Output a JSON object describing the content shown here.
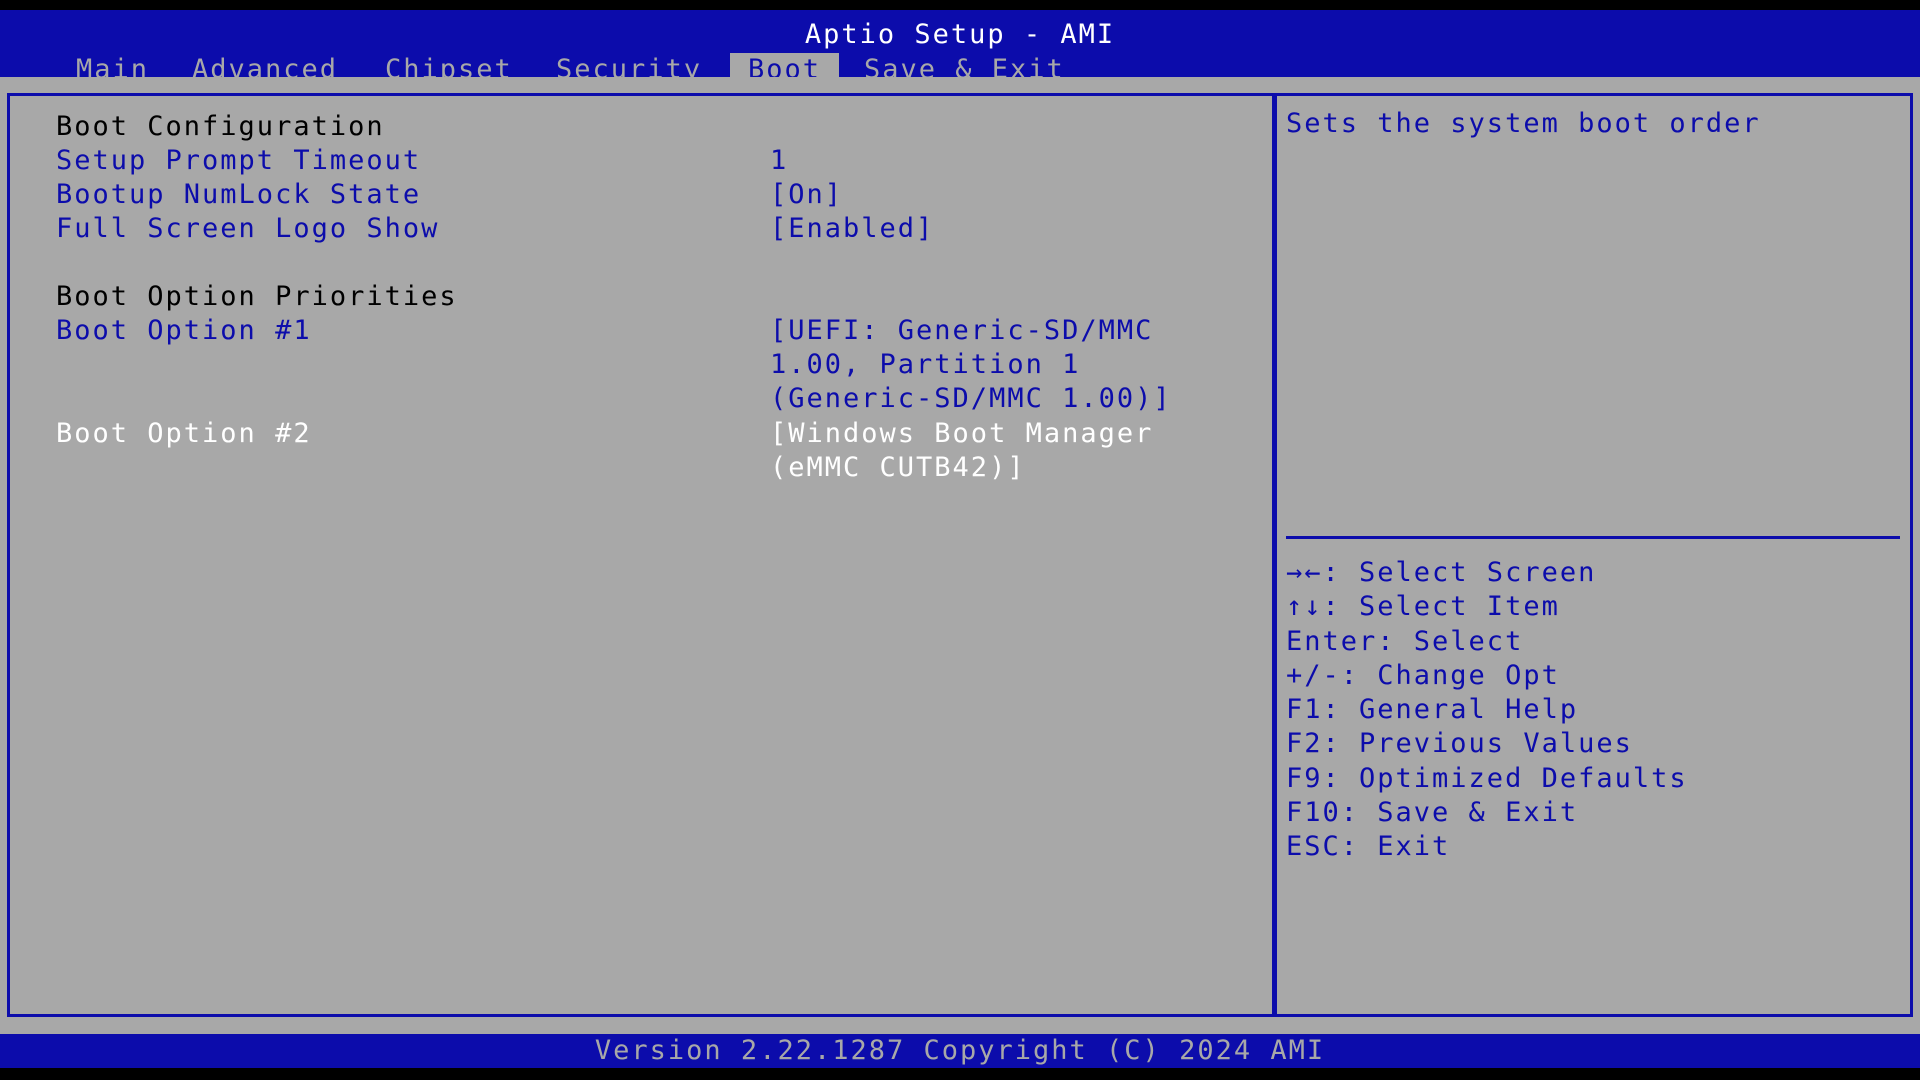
{
  "title": "Aptio Setup - AMI",
  "tabs": [
    {
      "label": "Main"
    },
    {
      "label": "Advanced"
    },
    {
      "label": "Chipset"
    },
    {
      "label": "Security"
    },
    {
      "label": "Boot",
      "active": true
    },
    {
      "label": "Save & Exit"
    }
  ],
  "boot_configuration": {
    "heading": "Boot Configuration",
    "setup_prompt_timeout": {
      "label": "Setup Prompt Timeout",
      "value": "1"
    },
    "numlock": {
      "label": "Bootup NumLock State",
      "value": "[On]"
    },
    "logo": {
      "label": "Full Screen Logo Show",
      "value": "[Enabled]"
    }
  },
  "boot_priorities": {
    "heading": "Boot Option Priorities",
    "option1": {
      "label": "Boot Option #1",
      "value_lines": [
        "[UEFI: Generic-SD/MMC",
        "1.00, Partition 1",
        "(Generic-SD/MMC 1.00)]"
      ]
    },
    "option2": {
      "label": "Boot Option #2",
      "value_lines": [
        "[Windows Boot Manager",
        "(eMMC CUTB42)]"
      ]
    }
  },
  "help": {
    "text": "Sets the system boot order"
  },
  "keys": [
    "→←: Select Screen",
    "↑↓: Select Item",
    "Enter: Select",
    "+/-: Change Opt",
    "F1: General Help",
    "F2: Previous Values",
    "F9: Optimized Defaults",
    "F10: Save & Exit",
    "ESC: Exit"
  ],
  "footer": {
    "version": "Version 2.22.1287 Copyright (C) 2024 AMI"
  },
  "colors": {
    "bios_blue": "#0c0cab",
    "bios_gray": "#a8a8a8",
    "white": "#ffffff"
  }
}
